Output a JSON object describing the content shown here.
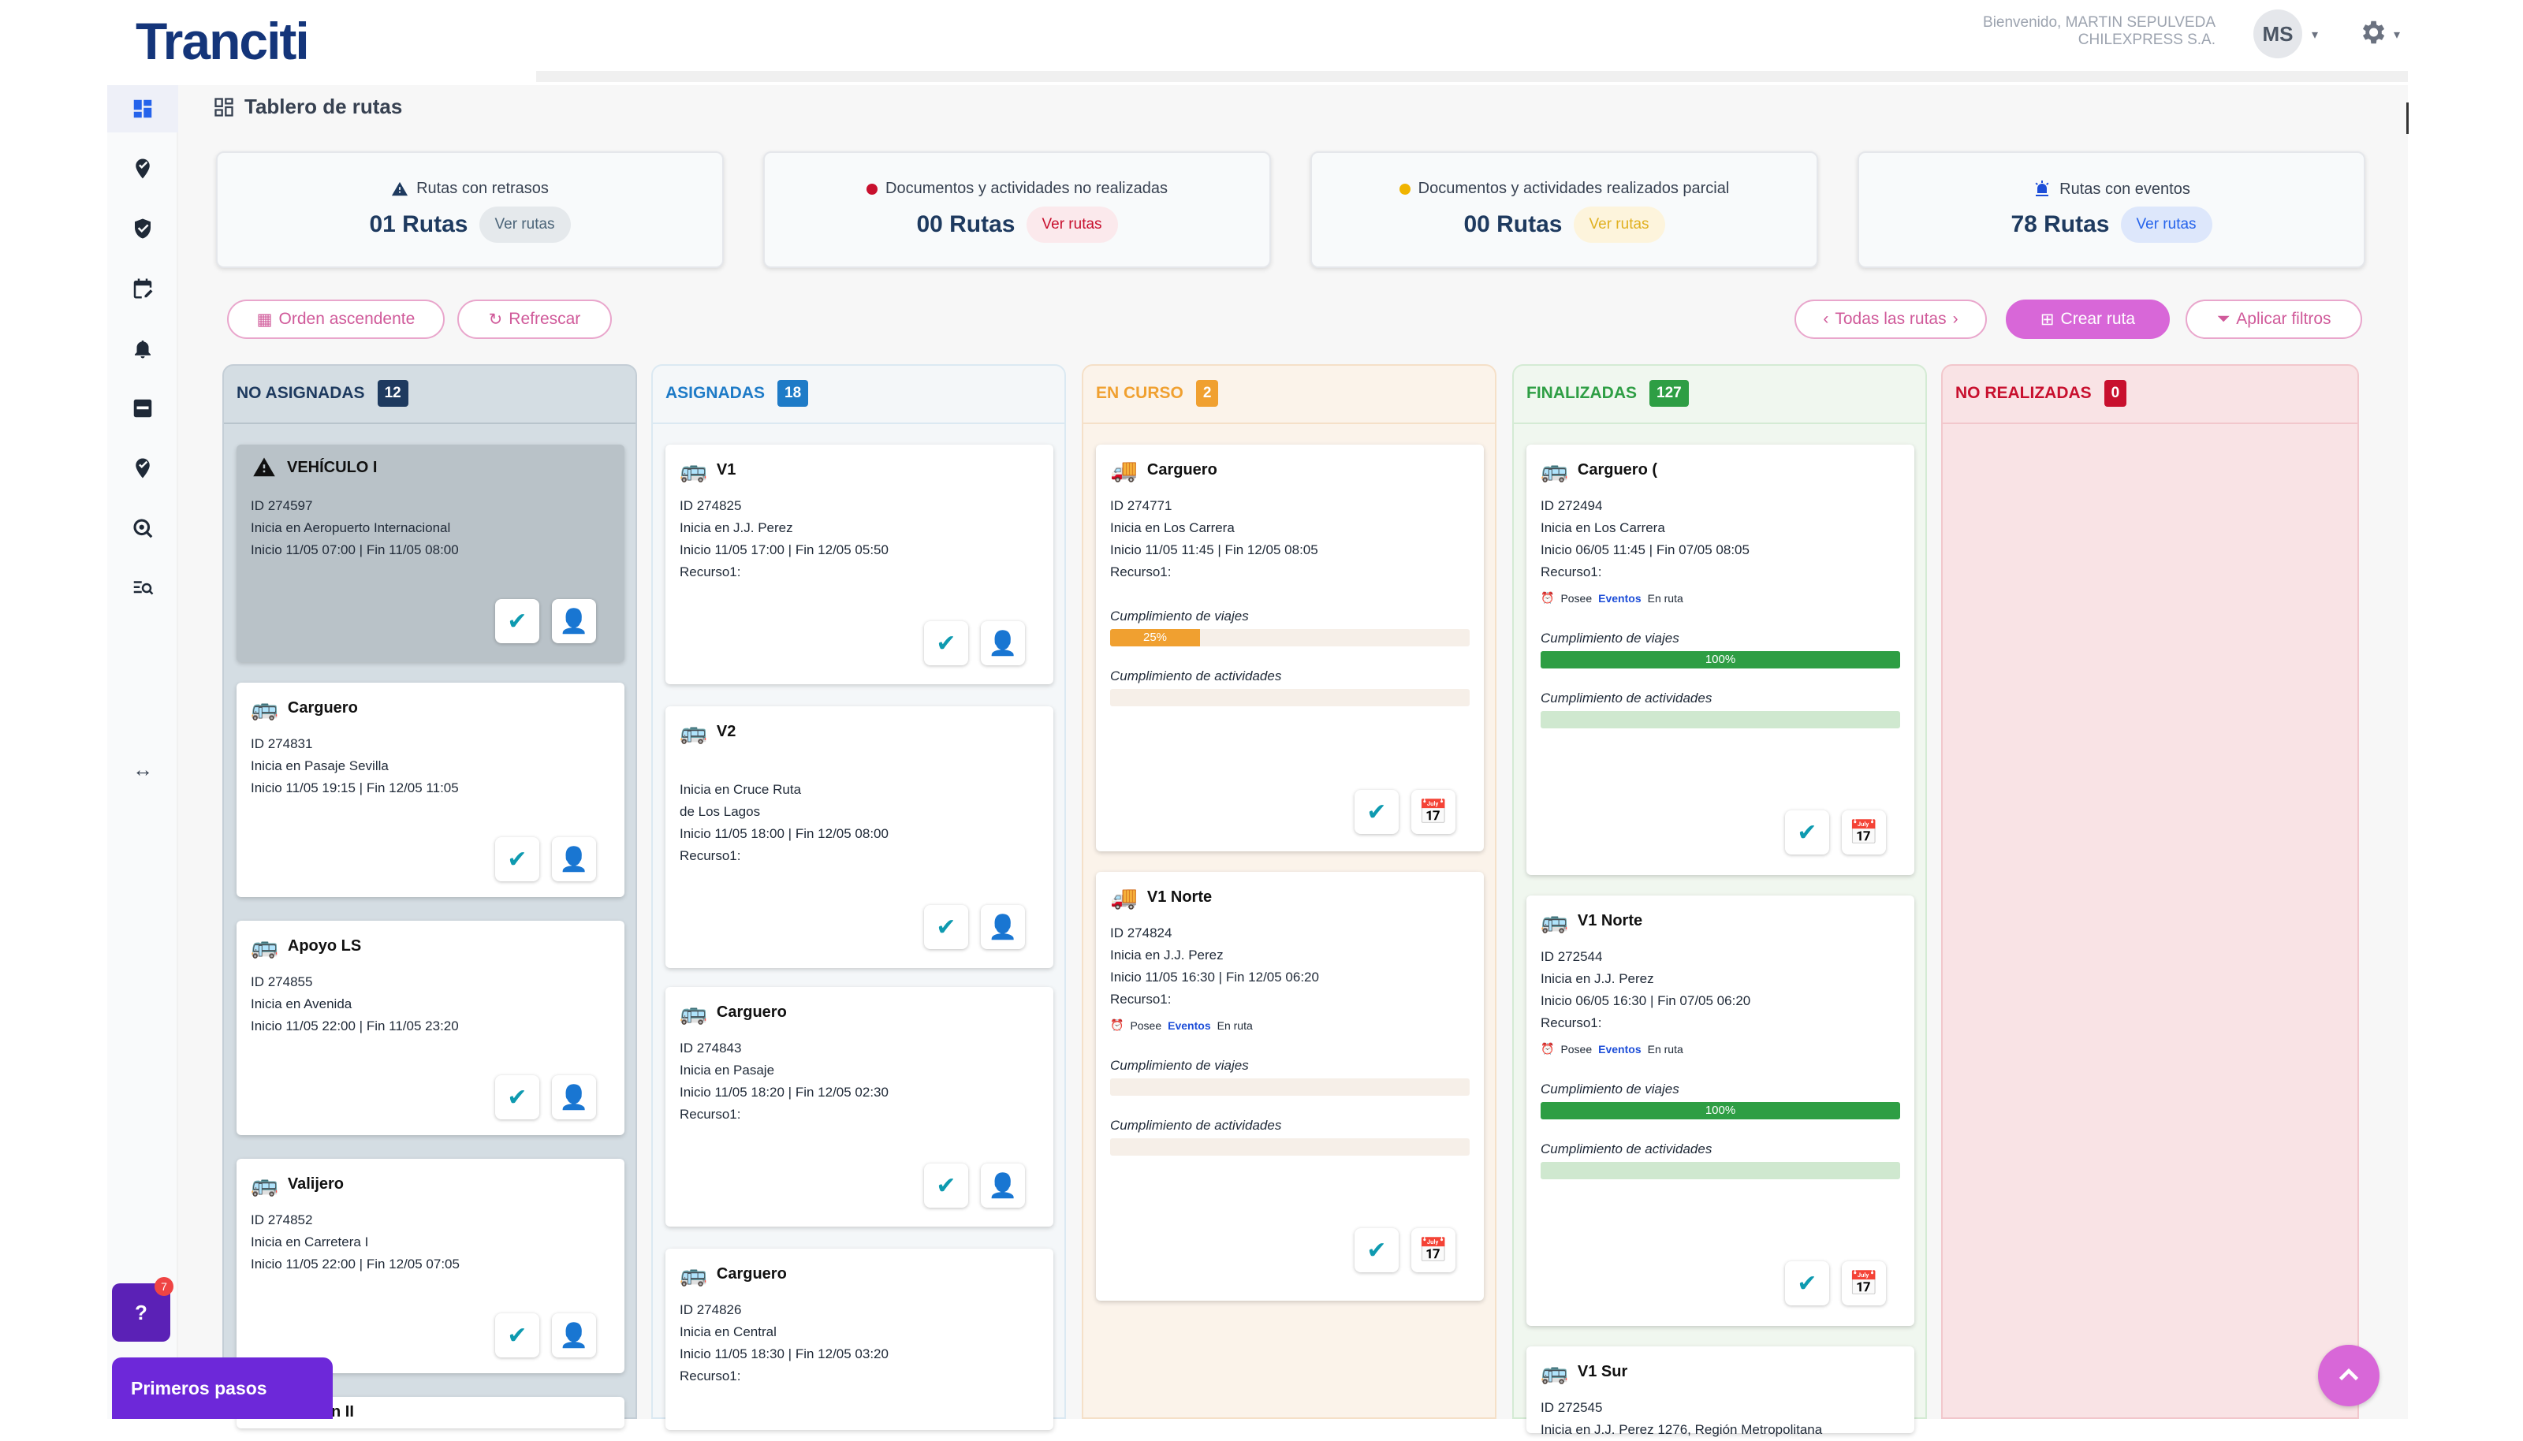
{
  "header": {
    "logo": "Tranciti",
    "welcome_line1": "Bienvenido, MARTIN SEPULVEDA",
    "welcome_line2": "CHILEXPRESS S.A.",
    "avatar_initials": "MS"
  },
  "page_title": "Tablero de rutas",
  "kpis": [
    {
      "label": "Rutas con retrasos",
      "value": "01 Rutas",
      "link": "Ver rutas"
    },
    {
      "label": "Documentos y actividades no realizadas",
      "value": "00 Rutas",
      "link": "Ver rutas"
    },
    {
      "label": "Documentos y actividades realizados parcial",
      "value": "00 Rutas",
      "link": "Ver rutas"
    },
    {
      "label": "Rutas con eventos",
      "value": "78 Rutas",
      "link": "Ver rutas"
    }
  ],
  "toolbar": {
    "order": "Orden ascendente",
    "refresh": "Refrescar",
    "all_routes": "Todas las rutas",
    "create": "Crear ruta",
    "filters": "Aplicar filtros"
  },
  "columns": [
    {
      "title": "NO ASIGNADAS",
      "count": "12"
    },
    {
      "title": "ASIGNADAS",
      "count": "18"
    },
    {
      "title": "EN CURSO",
      "count": "2"
    },
    {
      "title": "FINALIZADAS",
      "count": "127"
    },
    {
      "title": "NO REALIZADAS",
      "count": "0"
    }
  ],
  "col0": [
    {
      "name": "VEHÍCULO I",
      "id": "ID 274597",
      "start": "Inicia en Aeropuerto Internacional",
      "time": "Inicio 11/05 07:00 | Fin 11/05 08:00"
    },
    {
      "name": "Carguero",
      "id": "ID 274831",
      "start": "Inicia en Pasaje Sevilla",
      "time": "Inicio 11/05 19:15 | Fin 12/05 11:05"
    },
    {
      "name": "Apoyo LS",
      "id": "ID 274855",
      "start": "Inicia en Avenida",
      "time": "Inicio 11/05 22:00 | Fin 11/05 23:20"
    },
    {
      "name": "Valijero",
      "id": "ID 274852",
      "start": "Inicia en Carretera I",
      "time": "Inicio 11/05 22:00 | Fin 12/05 07:05"
    },
    {
      "name": "n II"
    }
  ],
  "col1": [
    {
      "name": "V1",
      "id": "ID 274825",
      "start": "Inicia en J.J. Perez",
      "time": "Inicio 11/05 17:00 | Fin 12/05 05:50",
      "resource": "Recurso1:"
    },
    {
      "name": "V2",
      "start1": "Inicia en Cruce Ruta",
      "start2": "de Los Lagos",
      "time": "Inicio 11/05 18:00 | Fin 12/05 08:00",
      "resource": "Recurso1:"
    },
    {
      "name": "Carguero",
      "id": "ID 274843",
      "start": "Inicia en Pasaje",
      "time": "Inicio 11/05 18:20 | Fin 12/05 02:30",
      "resource": "Recurso1:"
    },
    {
      "name": "Carguero",
      "id": "ID 274826",
      "start": "Inicia en Central",
      "time": "Inicio 11/05 18:30 | Fin 12/05 03:20",
      "resource": "Recurso1:"
    }
  ],
  "col2": [
    {
      "name": "Carguero",
      "id": "ID 274771",
      "start": "Inicia en Los Carrera",
      "time": "Inicio 11/05 11:45 | Fin 12/05 08:05",
      "resource": "Recurso1:",
      "trips_label": "Cumplimiento de viajes",
      "trips": 25,
      "trips_text": "25%",
      "acts_label": "Cumplimiento de actividades"
    },
    {
      "name": "V1 Norte",
      "id": "ID 274824",
      "start": "Inicia en J.J. Perez",
      "time": "Inicio 11/05 16:30 | Fin 12/05 06:20",
      "resource": "Recurso1:",
      "event_pre": "Posee",
      "event_link": "Eventos",
      "event_post": "En ruta",
      "trips_label": "Cumplimiento de viajes",
      "acts_label": "Cumplimiento de actividades"
    }
  ],
  "col3": [
    {
      "name": "Carguero (",
      "id": "ID 272494",
      "start": "Inicia en Los Carrera",
      "time": "Inicio 06/05 11:45 | Fin 07/05 08:05",
      "resource": "Recurso1:",
      "event_pre": "Posee",
      "event_link": "Eventos",
      "event_post": "En ruta",
      "trips_label": "Cumplimiento de viajes",
      "trips": 100,
      "trips_text": "100%",
      "acts_label": "Cumplimiento de actividades"
    },
    {
      "name": "V1 Norte",
      "id": "ID 272544",
      "start": "Inicia en J.J. Perez",
      "time": "Inicio 06/05 16:30 | Fin 07/05 06:20",
      "resource": "Recurso1:",
      "event_pre": "Posee",
      "event_link": "Eventos",
      "event_post": "En ruta",
      "trips_label": "Cumplimiento de viajes",
      "trips": 100,
      "trips_text": "100%",
      "acts_label": "Cumplimiento de actividades"
    },
    {
      "name": "V1 Sur",
      "id": "ID 272545",
      "start": "Inicia en J.J. Perez 1276, Región Metropolitana"
    }
  ],
  "help": {
    "label": "?",
    "badge": "7",
    "first_steps": "Primeros pasos"
  },
  "colors": {
    "brand": "#14357a",
    "accent": "#d867d8",
    "ok": "#2e9e44",
    "warn": "#f0a030",
    "danger": "#c8102e"
  }
}
